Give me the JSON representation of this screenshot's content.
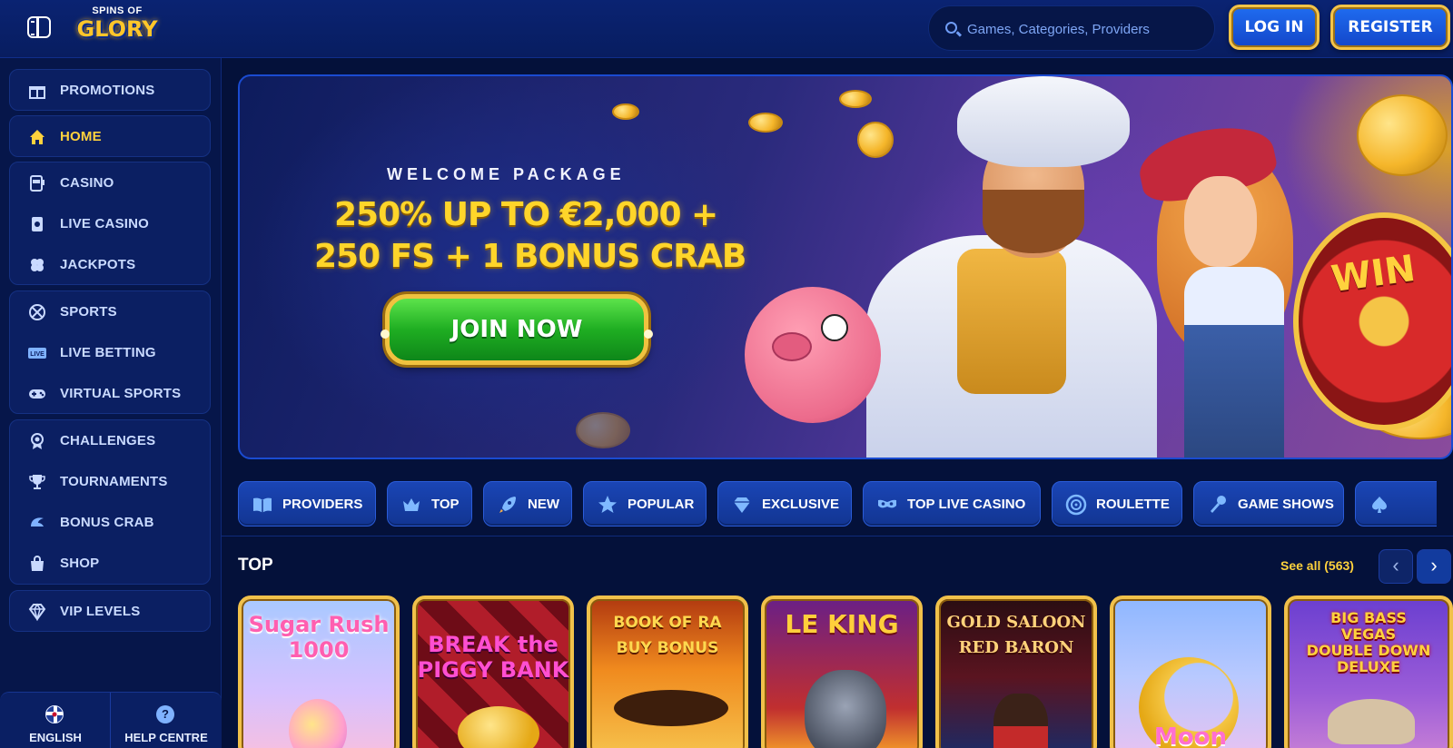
{
  "header": {
    "logo_top": "SPINS OF",
    "logo_main": "GLORY",
    "search_placeholder": "Games, Categories, Providers",
    "login_label": "LOG IN",
    "register_label": "REGISTER"
  },
  "sidebar": {
    "promotions": "PROMOTIONS",
    "home": "HOME",
    "casino": "CASINO",
    "live_casino": "LIVE CASINO",
    "jackpots": "JACKPOTS",
    "sports": "SPORTS",
    "live_betting": "LIVE BETTING",
    "virtual_sports": "VIRTUAL SPORTS",
    "challenges": "CHALLENGES",
    "tournaments": "TOURNAMENTS",
    "bonus_crab": "BONUS CRAB",
    "shop": "SHOP",
    "vip_levels": "VIP LEVELS",
    "language": "ENGLISH",
    "help": "HELP CENTRE",
    "help_icon_glyph": "?"
  },
  "banner": {
    "kicker": "WELCOME PACKAGE",
    "offer_line1": "250% UP TO €2,000 +",
    "offer_line2": "250 FS + 1 BONUS CRAB",
    "cta": "JOIN NOW",
    "wheel_label": "WIN"
  },
  "categories": [
    {
      "label": "PROVIDERS",
      "icon": "book-icon"
    },
    {
      "label": "TOP",
      "icon": "crown-icon"
    },
    {
      "label": "NEW",
      "icon": "rocket-icon"
    },
    {
      "label": "POPULAR",
      "icon": "star-icon"
    },
    {
      "label": "EXCLUSIVE",
      "icon": "diamond-icon"
    },
    {
      "label": "TOP LIVE CASINO",
      "icon": "mask-icon"
    },
    {
      "label": "ROULETTE",
      "icon": "roulette-icon"
    },
    {
      "label": "GAME SHOWS",
      "icon": "microphone-icon"
    },
    {
      "label": "",
      "icon": "spade-icon"
    }
  ],
  "top_section": {
    "title": "TOP",
    "see_all": "See all (563)",
    "prev_glyph": "‹",
    "next_glyph": "›"
  },
  "games": [
    {
      "title": "Sugar Rush\n1000"
    },
    {
      "title": "BREAK the\nPIGGY BANK"
    },
    {
      "title": "BOOK OF RA\nBUY BONUS"
    },
    {
      "title": "LE KING"
    },
    {
      "title": "GOLD SALOON\nRED BARON"
    },
    {
      "title": "Moon"
    },
    {
      "title": "BIG BASS\nVEGAS\nDOUBLE DOWN\nDELUXE"
    }
  ],
  "colors": {
    "accent_gold": "#ffd23d",
    "primary_blue": "#1a45b5",
    "background": "#04113a",
    "cta_green": "#1fae22"
  }
}
